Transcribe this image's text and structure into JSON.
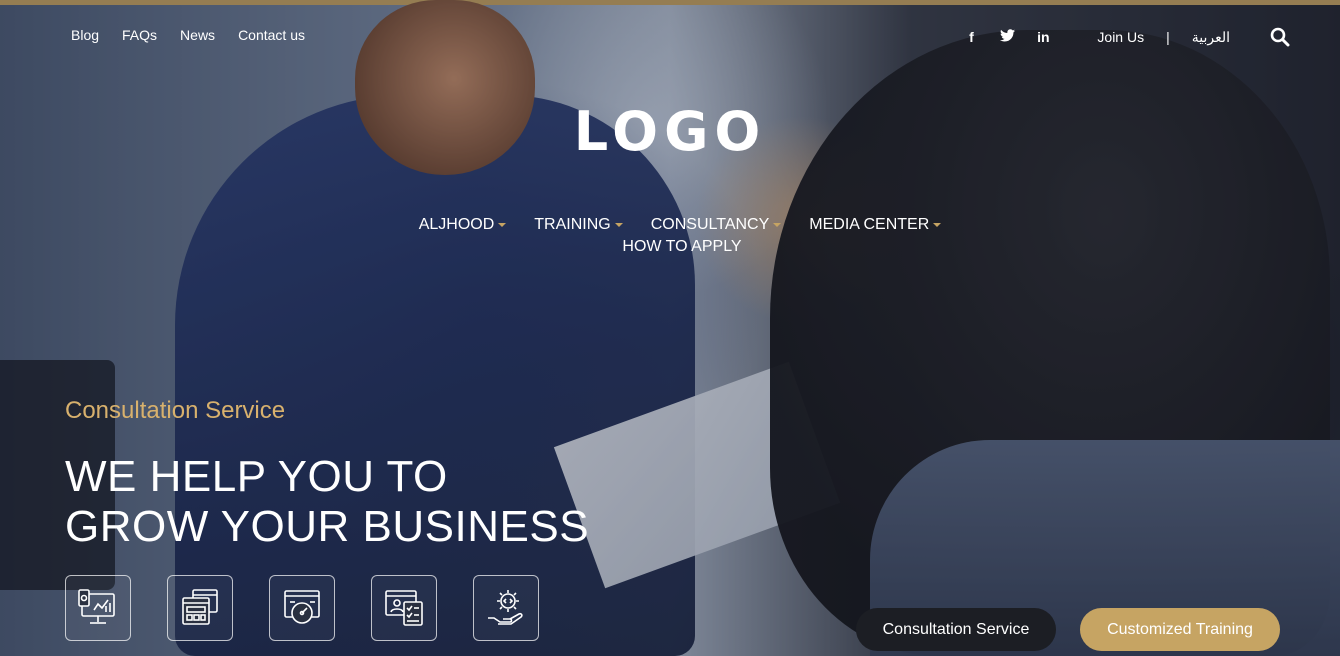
{
  "topbar": {
    "links": [
      "Blog",
      "FAQs",
      "News",
      "Contact us"
    ],
    "social": [
      {
        "name": "facebook-icon",
        "glyph": "f"
      },
      {
        "name": "twitter-icon",
        "glyph": "🐦"
      },
      {
        "name": "linkedin-icon",
        "glyph": "in"
      }
    ],
    "join_label": "Join Us",
    "separator": "|",
    "language_label": "العربية",
    "search_icon": "search-icon"
  },
  "logo_text": "LOGO",
  "nav": {
    "items": [
      {
        "label": "ALJHOOD",
        "has_dropdown": true
      },
      {
        "label": "TRAINING",
        "has_dropdown": true
      },
      {
        "label": "CONSULTANCY",
        "has_dropdown": true
      },
      {
        "label": "MEDIA CENTER",
        "has_dropdown": true
      }
    ],
    "second_row": "HOW TO APPLY"
  },
  "hero": {
    "eyebrow": "Consultation Service",
    "headline_line1": "WE HELP YOU TO",
    "headline_line2": "GROW YOUR BUSINESS"
  },
  "service_icons": [
    "analytics-monitor-icon",
    "web-layout-icon",
    "performance-gauge-icon",
    "profile-checklist-icon",
    "code-gear-hand-icon"
  ],
  "cta": {
    "primary": "Consultation Service",
    "secondary": "Customized Training"
  },
  "colors": {
    "accent": "#c6a463",
    "dark_button": "#1c1e24"
  }
}
